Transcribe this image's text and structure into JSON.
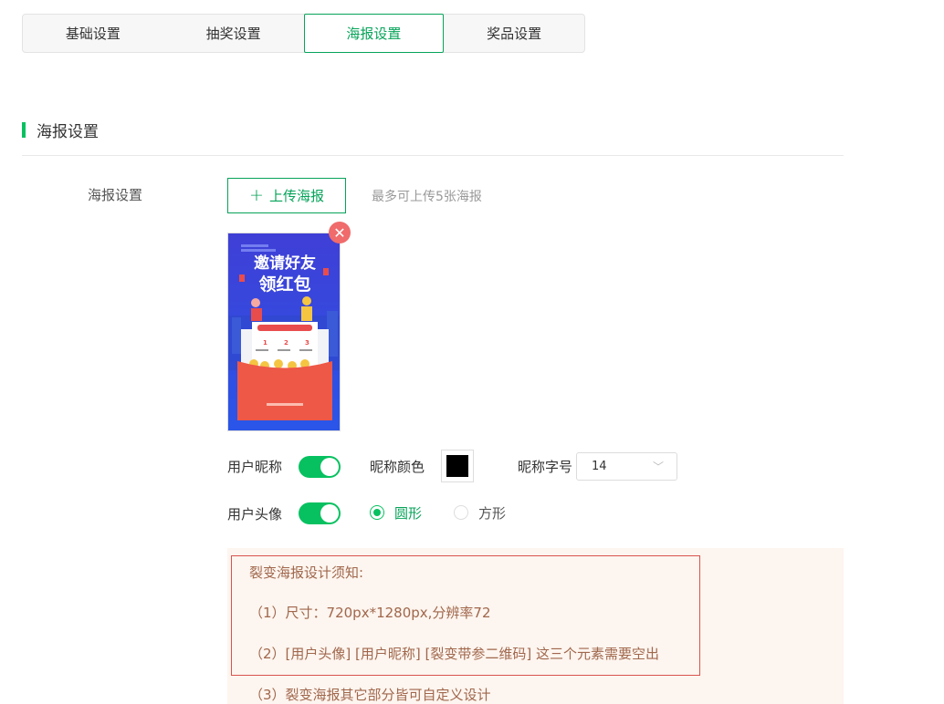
{
  "tabs": [
    {
      "label": "基础设置",
      "active": false
    },
    {
      "label": "抽奖设置",
      "active": false
    },
    {
      "label": "海报设置",
      "active": true
    },
    {
      "label": "奖品设置",
      "active": false
    }
  ],
  "section": {
    "title": "海报设置"
  },
  "poster_field": {
    "label": "海报设置",
    "upload_label": "上传海报",
    "upload_icon": "plus-icon",
    "hint": "最多可上传5张海报"
  },
  "poster_image": {
    "heading_line1": "邀请好友",
    "heading_line2": "领红包",
    "remove_icon": "close-icon"
  },
  "nickname_row": {
    "label": "用户昵称",
    "enabled": true,
    "color_label": "昵称颜色",
    "color_value": "#000000",
    "size_label": "昵称字号",
    "size_value": "14"
  },
  "avatar_row": {
    "label": "用户头像",
    "enabled": true,
    "shape_options": [
      {
        "label": "圆形",
        "checked": true
      },
      {
        "label": "方形",
        "checked": false
      }
    ]
  },
  "notice": {
    "title": "裂变海报设计须知:",
    "items": [
      "（1）尺寸：720px*1280px,分辨率72",
      "（2）[用户头像] [用户昵称] [裂变带参二维码] 这三个元素需要空出",
      "（3）裂变海报其它部分皆可自定义设计"
    ]
  },
  "colors": {
    "accent": "#07c160",
    "accent_text": "#07a35a",
    "danger": "#d9534f",
    "notice_text": "#a0674c"
  }
}
